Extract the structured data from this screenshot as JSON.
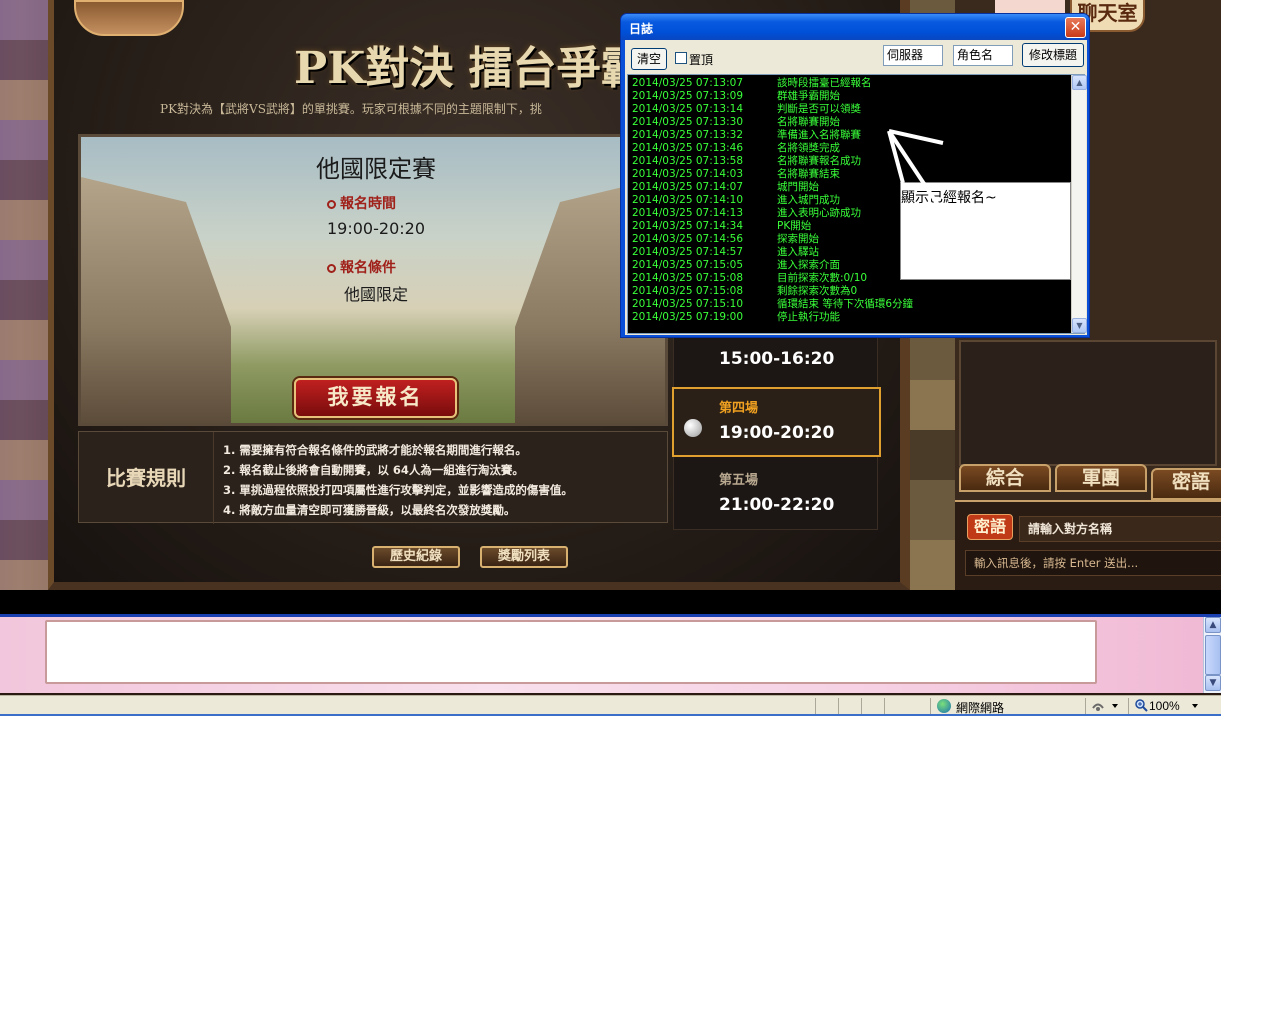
{
  "game": {
    "pk_title": "PK對決 擂台爭霸",
    "pk_subtitle": "PK對決為【武將VS武將】的單挑賽。玩家可根據不同的主題限制下，挑",
    "scene_title": "他國限定賽",
    "signup_time_label": "報名時間",
    "signup_time_value": "19:00-20:20",
    "signup_cond_label": "報名條件",
    "signup_cond_value": "他國限定",
    "register_button": "我要報名",
    "rules_title": "比賽規則",
    "rules": [
      "1. 需要擁有符合報名條件的武將才能於報名期間進行報名。",
      "2. 報名截止後將會自動開賽，以 64人為一組進行淘汰賽。",
      "3. 單挑過程依照投打四項屬性進行攻擊判定，並影響造成的傷害值。",
      "4. 將敵方血量清空即可獲勝晉級，以最終名次發放獎勵。"
    ],
    "history_button": "歷史紀錄",
    "reward_button": "獎勵列表",
    "schedule": [
      {
        "name": "",
        "time": "15:00-16:20"
      },
      {
        "name": "第四場",
        "time": "19:00-20:20"
      },
      {
        "name": "第五場",
        "time": "21:00-22:20"
      }
    ]
  },
  "chat": {
    "title": "聊天室",
    "tabs": [
      "綜合",
      "軍團",
      "密語"
    ],
    "whisper_badge": "密語",
    "whisper_target_placeholder": "請輸入對方名稱",
    "input_placeholder": "輸入訊息後，請按 Enter 送出..."
  },
  "log_window": {
    "title": "日誌",
    "clear_button": "清空",
    "pin_label": "置頂",
    "server_value": "伺服器",
    "char_value": "角色名",
    "rename_button": "修改標題",
    "lines": [
      {
        "ts": "2014/03/25 07:13:07",
        "msg": "該時段擂臺已經報名"
      },
      {
        "ts": "2014/03/25 07:13:09",
        "msg": "群雄爭霸開始"
      },
      {
        "ts": "2014/03/25 07:13:14",
        "msg": "判斷是否可以領獎"
      },
      {
        "ts": "2014/03/25 07:13:30",
        "msg": "名將聯賽開始"
      },
      {
        "ts": "2014/03/25 07:13:32",
        "msg": "準備進入名將聯賽"
      },
      {
        "ts": "2014/03/25 07:13:46",
        "msg": "名將領獎完成"
      },
      {
        "ts": "2014/03/25 07:13:58",
        "msg": "名將聯賽報名成功"
      },
      {
        "ts": "2014/03/25 07:14:03",
        "msg": "名將聯賽結束"
      },
      {
        "ts": "2014/03/25 07:14:07",
        "msg": "城門開始"
      },
      {
        "ts": "2014/03/25 07:14:10",
        "msg": "進入城門成功"
      },
      {
        "ts": "2014/03/25 07:14:13",
        "msg": "進入表明心跡成功"
      },
      {
        "ts": "2014/03/25 07:14:34",
        "msg": "PK開始"
      },
      {
        "ts": "2014/03/25 07:14:56",
        "msg": "探索開始"
      },
      {
        "ts": "2014/03/25 07:14:57",
        "msg": "進入驛站"
      },
      {
        "ts": "2014/03/25 07:15:05",
        "msg": "進入探索介面"
      },
      {
        "ts": "2014/03/25 07:15:08",
        "msg": "目前探索次數:0/10"
      },
      {
        "ts": "2014/03/25 07:15:08",
        "msg": "剩餘探索次數為0"
      },
      {
        "ts": "2014/03/25 07:15:10",
        "msg": "循環結束  等待下次循環6分鐘"
      },
      {
        "ts": "2014/03/25 07:19:00",
        "msg": "停止執行功能"
      }
    ],
    "annotation": "顯示已經報名~"
  },
  "statusbar": {
    "zone": "網際網路",
    "zoom": "100%"
  },
  "colors": {
    "log_text": "#39ff39",
    "title_blue": "#0a5ae0",
    "slot_active": "#e0a030",
    "register_red": "#c02020"
  }
}
